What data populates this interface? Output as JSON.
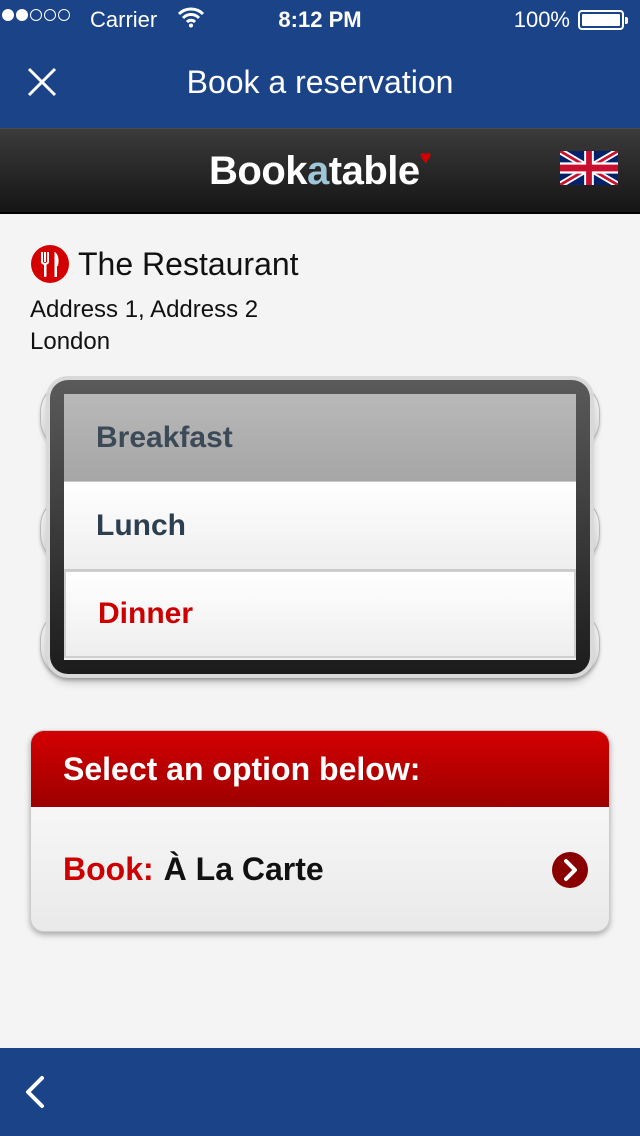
{
  "status_bar": {
    "carrier": "Carrier",
    "time": "8:12 PM",
    "battery": "100%",
    "signal_icon": "signal-dots-icon",
    "wifi_icon": "wifi-icon",
    "battery_icon": "battery-icon"
  },
  "nav": {
    "title": "Book a reservation",
    "close_icon": "close-icon"
  },
  "brand": {
    "logo_prefix": "Book",
    "logo_a": "a",
    "logo_suffix": "table",
    "flag_icon": "uk-flag-icon"
  },
  "restaurant": {
    "name": "The Restaurant",
    "address_line1": "Address 1, Address 2",
    "address_line2": "London",
    "icon": "cutlery-icon"
  },
  "meal_picker": {
    "options": [
      "Breakfast",
      "Lunch",
      "Dinner"
    ],
    "selected": "Dinner"
  },
  "options_panel": {
    "heading": "Select an option below:",
    "book_label": "Book:",
    "book_value": "À La Carte",
    "chevron_icon": "chevron-right-icon"
  },
  "bottom_bar": {
    "back_icon": "back-arrow-icon"
  },
  "colors": {
    "nav_blue": "#1b4388",
    "accent_red": "#cc0000"
  }
}
